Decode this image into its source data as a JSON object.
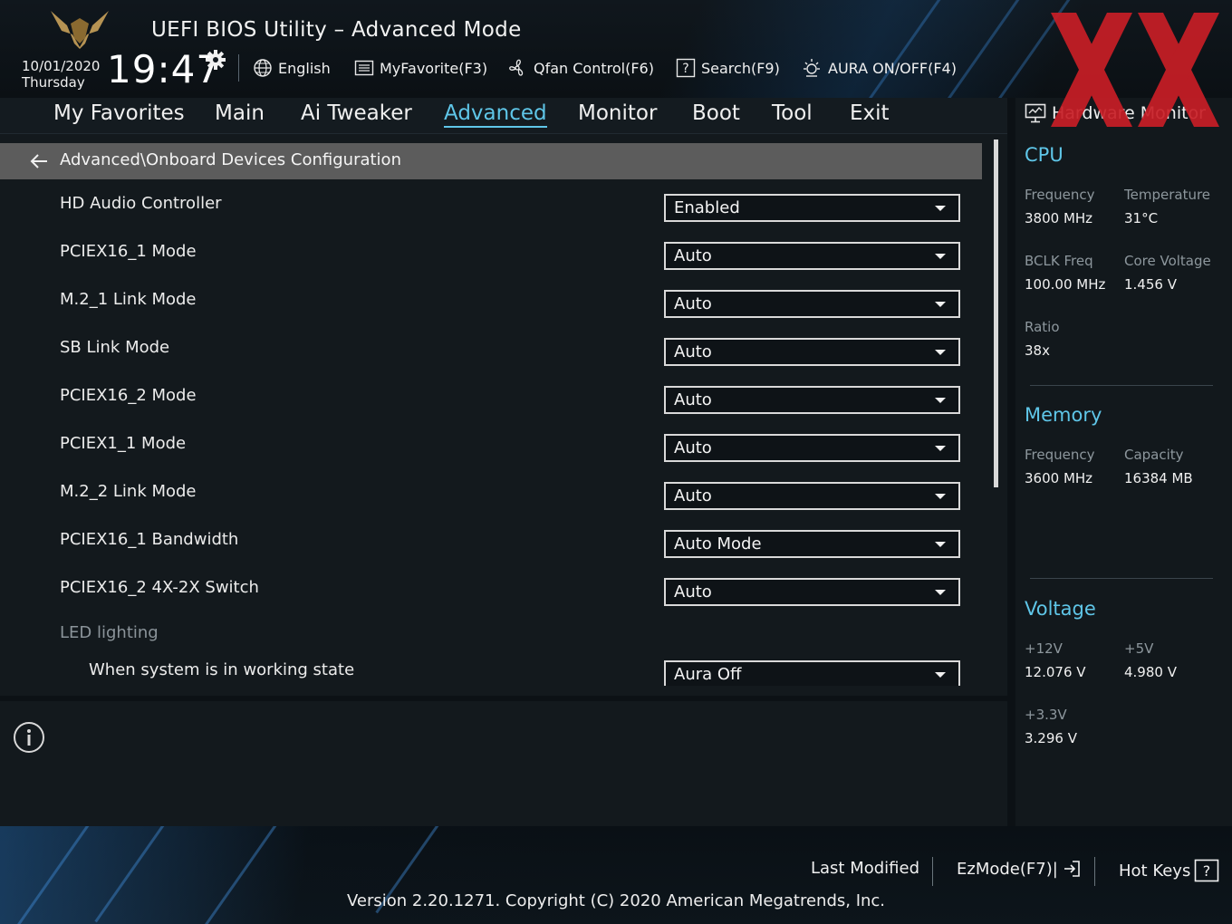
{
  "header": {
    "title": "UEFI BIOS Utility – Advanced Mode",
    "date": "10/01/2020",
    "day": "Thursday",
    "time": "19:47",
    "toolbar": [
      {
        "label": "English",
        "icon": "globe-icon"
      },
      {
        "label": "MyFavorite(F3)",
        "icon": "favorites-list-icon"
      },
      {
        "label": "Qfan Control(F6)",
        "icon": "fan-icon"
      },
      {
        "label": "Search(F9)",
        "icon": "search-help-icon"
      },
      {
        "label": "AURA ON/OFF(F4)",
        "icon": "aura-light-icon"
      }
    ]
  },
  "menu": {
    "items": [
      "My Favorites",
      "Main",
      "Ai Tweaker",
      "Advanced",
      "Monitor",
      "Boot",
      "Tool",
      "Exit"
    ],
    "active": "Advanced"
  },
  "breadcrumb": "Advanced\\Onboard Devices Configuration",
  "settings": [
    {
      "label": "HD Audio Controller",
      "value": "Enabled"
    },
    {
      "label": "PCIEX16_1 Mode",
      "value": "Auto"
    },
    {
      "label": "M.2_1 Link Mode",
      "value": "Auto"
    },
    {
      "label": "SB Link Mode",
      "value": "Auto"
    },
    {
      "label": "PCIEX16_2 Mode",
      "value": "Auto"
    },
    {
      "label": "PCIEX1_1 Mode",
      "value": "Auto"
    },
    {
      "label": "M.2_2 Link Mode",
      "value": "Auto"
    },
    {
      "label": "PCIEX16_1 Bandwidth",
      "value": "Auto Mode"
    },
    {
      "label": "PCIEX16_2 4X-2X Switch",
      "value": "Auto"
    },
    {
      "label": "LED lighting"
    },
    {
      "label": "When system is in working state",
      "value": "Aura Off"
    }
  ],
  "hardware_monitor": {
    "title": "Hardware Monitor",
    "cpu": {
      "title": "CPU",
      "frequency_label": "Frequency",
      "frequency": "3800 MHz",
      "temperature_label": "Temperature",
      "temperature": "31°C",
      "bclk_label": "BCLK Freq",
      "bclk": "100.00 MHz",
      "core_voltage_label": "Core Voltage",
      "core_voltage": "1.456 V",
      "ratio_label": "Ratio",
      "ratio": "38x"
    },
    "memory": {
      "title": "Memory",
      "frequency_label": "Frequency",
      "frequency": "3600 MHz",
      "capacity_label": "Capacity",
      "capacity": "16384 MB"
    },
    "voltage": {
      "title": "Voltage",
      "v12_label": "+12V",
      "v12": "12.076 V",
      "v5_label": "+5V",
      "v5": "4.980 V",
      "v33_label": "+3.3V",
      "v33": "3.296 V"
    }
  },
  "footer": {
    "last_modified": "Last Modified",
    "ezmode": "EzMode(F7)|",
    "hot_keys": "Hot Keys",
    "version": "Version 2.20.1271. Copyright (C) 2020 American Megatrends, Inc."
  },
  "colors": {
    "accent": "#5fc6e8",
    "watermark": "#d0202a",
    "breadcrumb_bg": "#5c5c5c"
  }
}
